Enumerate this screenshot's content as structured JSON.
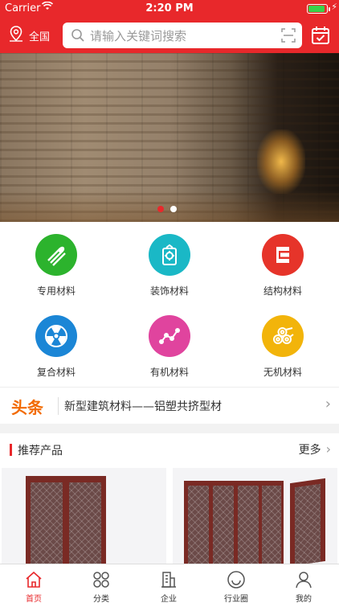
{
  "status_bar": {
    "carrier": "Carrier",
    "time": "2:20 PM",
    "battery_level": 0.92
  },
  "nav": {
    "location": "全国",
    "search_placeholder": "请输入关键词搜索"
  },
  "banner": {
    "slide_count": 2,
    "active_index": 1
  },
  "categories": [
    {
      "label": "专用材料",
      "icon": "pipes-icon",
      "color": "#2cb32d"
    },
    {
      "label": "装饰材料",
      "icon": "decor-badge-icon",
      "color": "#1ab8c6"
    },
    {
      "label": "结构材料",
      "icon": "structure-icon",
      "color": "#e6342a"
    },
    {
      "label": "复合材料",
      "icon": "radiation-icon",
      "color": "#1b86d6"
    },
    {
      "label": "有机材料",
      "icon": "molecule-icon",
      "color": "#e0449e"
    },
    {
      "label": "无机材料",
      "icon": "logs-icon",
      "color": "#f2b40a"
    }
  ],
  "headline": {
    "tag": "头条",
    "text": "新型建筑材料——铝塑共挤型材"
  },
  "recommend": {
    "title": "推荐产品",
    "more": "更多"
  },
  "tabs": [
    {
      "label": "首页",
      "icon": "home-icon",
      "active": true
    },
    {
      "label": "分类",
      "icon": "category-icon",
      "active": false
    },
    {
      "label": "企业",
      "icon": "building-icon",
      "active": false
    },
    {
      "label": "行业圈",
      "icon": "circle-smile-icon",
      "active": false
    },
    {
      "label": "我的",
      "icon": "user-icon",
      "active": false
    }
  ],
  "colors": {
    "brand": "#e8282b",
    "headline_tag": "#f26a00"
  }
}
